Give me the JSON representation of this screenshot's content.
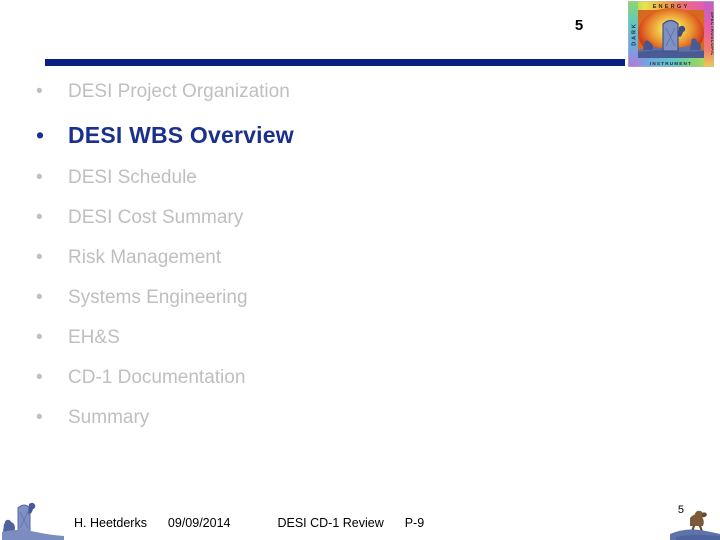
{
  "slide": {
    "page_number_top": "5",
    "page_number_bottom": "5",
    "rule_color": "#0a2080",
    "muted_text_color": "#bfbfbf",
    "accent_text_color": "#1b2f8e"
  },
  "agenda": {
    "items": [
      {
        "marker": "•",
        "label": "DESI Project Organization",
        "current": false
      },
      {
        "marker": "•",
        "label": "DESI WBS Overview",
        "current": true
      },
      {
        "marker": "•",
        "label": "DESI Schedule",
        "current": false
      },
      {
        "marker": "•",
        "label": "DESI Cost Summary",
        "current": false
      },
      {
        "marker": "•",
        "label": "Risk Management",
        "current": false
      },
      {
        "marker": "•",
        "label": "Systems Engineering",
        "current": false
      },
      {
        "marker": "•",
        "label": "EH&S",
        "current": false
      },
      {
        "marker": "•",
        "label": "CD-1 Documentation",
        "current": false
      },
      {
        "marker": "•",
        "label": "Summary",
        "current": false
      }
    ]
  },
  "footer": {
    "author": "H. Heetderks",
    "date": "09/09/2014",
    "review": "DESI CD-1 Review",
    "page_label": "P-9"
  },
  "logo": {
    "name": "desi-logo",
    "border_top_text": "ENERGY",
    "border_left_text": "DARK",
    "border_right_text": "SPECTROSCOPIC",
    "border_bottom_text": "INSTRUMENT"
  }
}
